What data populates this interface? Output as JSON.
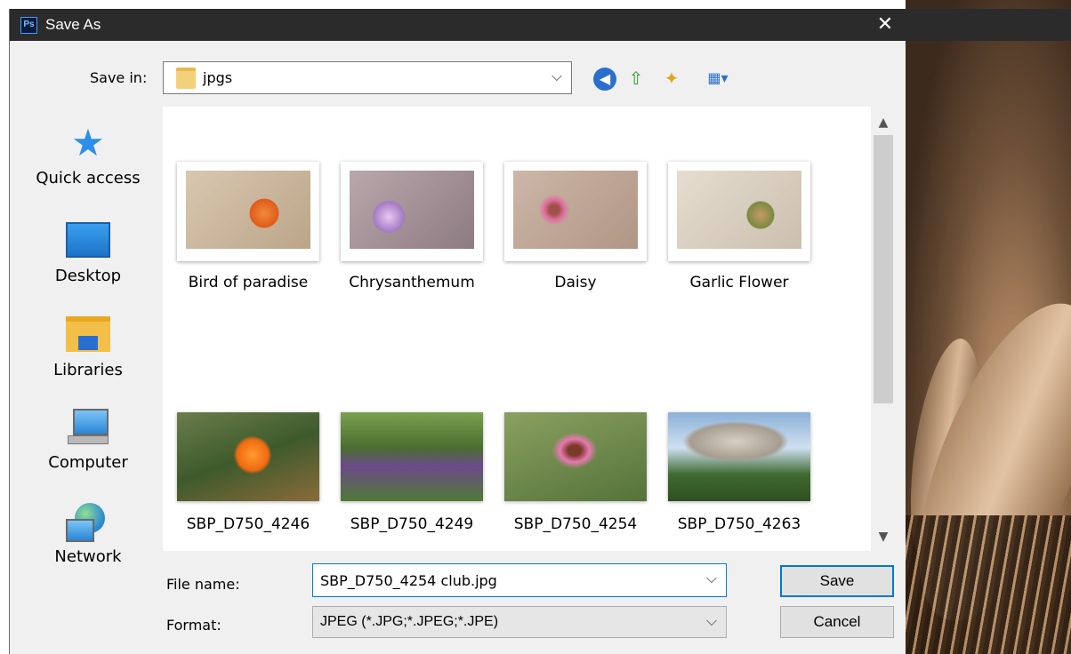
{
  "dialog": {
    "app_badge": "Ps",
    "title": "Save As",
    "close_glyph": "✕"
  },
  "save_in": {
    "label": "Save in:",
    "value": "jpgs"
  },
  "toolbar": {
    "icons": [
      "back-icon",
      "up-folder-icon",
      "new-folder-icon",
      "view-menu-icon"
    ]
  },
  "places": [
    {
      "label": "Quick access",
      "icon": "star-icon"
    },
    {
      "label": "Desktop",
      "icon": "desktop-icon"
    },
    {
      "label": "Libraries",
      "icon": "libraries-icon"
    },
    {
      "label": "Computer",
      "icon": "computer-icon"
    },
    {
      "label": "Network",
      "icon": "network-icon"
    }
  ],
  "files": [
    {
      "name": "Bird of paradise"
    },
    {
      "name": "Chrysanthemum"
    },
    {
      "name": "Daisy"
    },
    {
      "name": "Garlic Flower"
    },
    {
      "name": "SBP_D750_4246"
    },
    {
      "name": "SBP_D750_4249"
    },
    {
      "name": "SBP_D750_4254"
    },
    {
      "name": "SBP_D750_4263"
    }
  ],
  "file_name": {
    "label": "File name:",
    "value": "SBP_D750_4254 club.jpg"
  },
  "format": {
    "label": "Format:",
    "value": "JPEG (*.JPG;*.JPEG;*.JPE)"
  },
  "buttons": {
    "save": "Save",
    "cancel": "Cancel"
  },
  "colors": {
    "titlebar": "#2b2b2b",
    "accent": "#0078d7"
  }
}
